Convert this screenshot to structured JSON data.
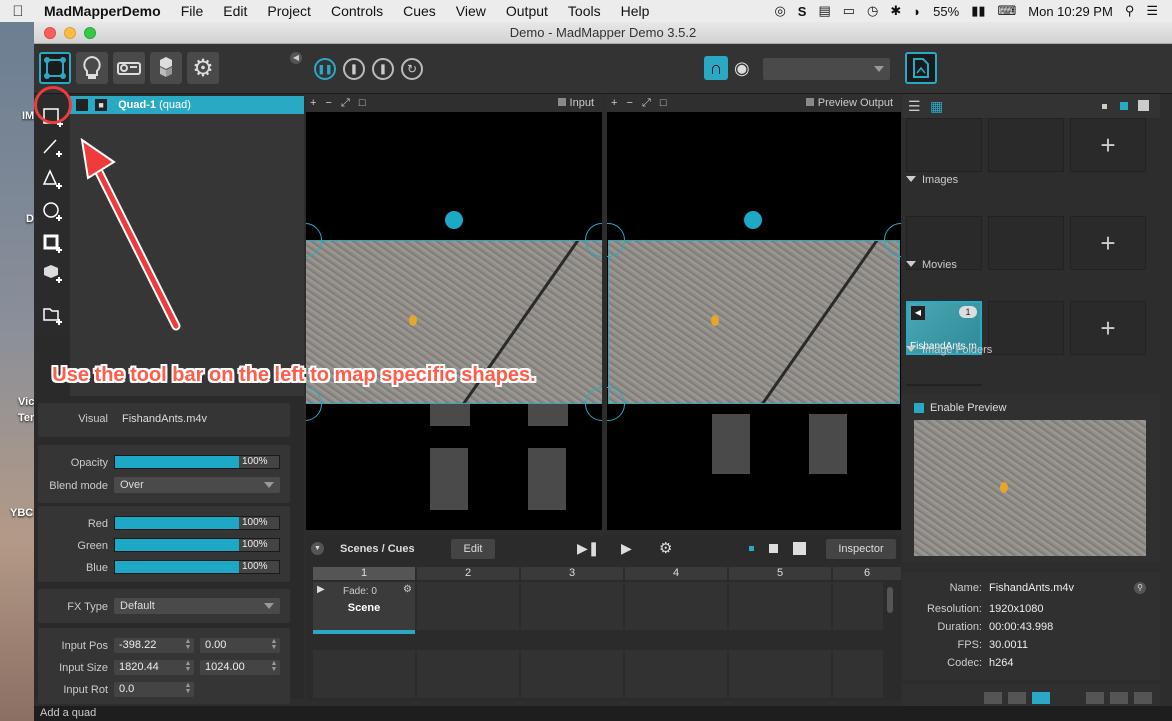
{
  "menubar": {
    "app_name": "MadMapperDemo",
    "items": [
      "File",
      "Edit",
      "Project",
      "Controls",
      "Cues",
      "View",
      "Output",
      "Tools",
      "Help"
    ],
    "battery": "55%",
    "clock": "Mon 10:29 PM"
  },
  "desktop": {
    "labels": [
      "IM",
      "D",
      "Vic",
      "Ter",
      "YBC"
    ]
  },
  "window": {
    "title": "Demo - MadMapper Demo 3.5.2"
  },
  "layers": {
    "selected_name": "Quad-1",
    "selected_type": "(quad)"
  },
  "input_view": {
    "label": "Input"
  },
  "output_view": {
    "label": "Preview Output"
  },
  "properties": {
    "visual_label": "Visual",
    "visual_value": "FishandAnts.m4v",
    "opacity_label": "Opacity",
    "opacity_value": "100%",
    "opacity_level": 1.0,
    "blend_label": "Blend mode",
    "blend_value": "Over",
    "red_label": "Red",
    "red_value": "100%",
    "green_label": "Green",
    "green_value": "100%",
    "blue_label": "Blue",
    "blue_value": "100%",
    "fx_label": "FX Type",
    "fx_value": "Default",
    "input_pos_label": "Input Pos",
    "input_pos_x": "-398.22",
    "input_pos_y": "0.00",
    "input_size_label": "Input Size",
    "input_size_w": "1820.44",
    "input_size_h": "1024.00",
    "input_rot_label": "Input Rot",
    "input_rot_value": "0.0"
  },
  "media": {
    "images_label": "Images",
    "movies_label": "Movies",
    "image_folders_label": "Image Folders",
    "movie_name": "FishandAnts.m",
    "movie_badge": "1",
    "plus": "+"
  },
  "preview": {
    "enable_label": "Enable Preview"
  },
  "info": {
    "name_label": "Name:",
    "name_value": "FishandAnts.m4v",
    "resolution_label": "Resolution:",
    "resolution_value": "1920x1080",
    "duration_label": "Duration:",
    "duration_value": "00:00:43.998",
    "fps_label": "FPS:",
    "fps_value": "30.0011",
    "codec_label": "Codec:",
    "codec_value": "h264"
  },
  "scenes": {
    "title": "Scenes / Cues",
    "edit_label": "Edit",
    "inspector_label": "Inspector",
    "columns": [
      "1",
      "2",
      "3",
      "4",
      "5",
      "6"
    ],
    "fade_label": "Fade: 0",
    "scene_label": "Scene"
  },
  "status": {
    "text": "Add a quad"
  },
  "callout": {
    "text": "Use the tool bar on the left to map specific shapes."
  },
  "colors": {
    "accent": "#2aa9c4",
    "annotation": "#ef3b3b"
  }
}
